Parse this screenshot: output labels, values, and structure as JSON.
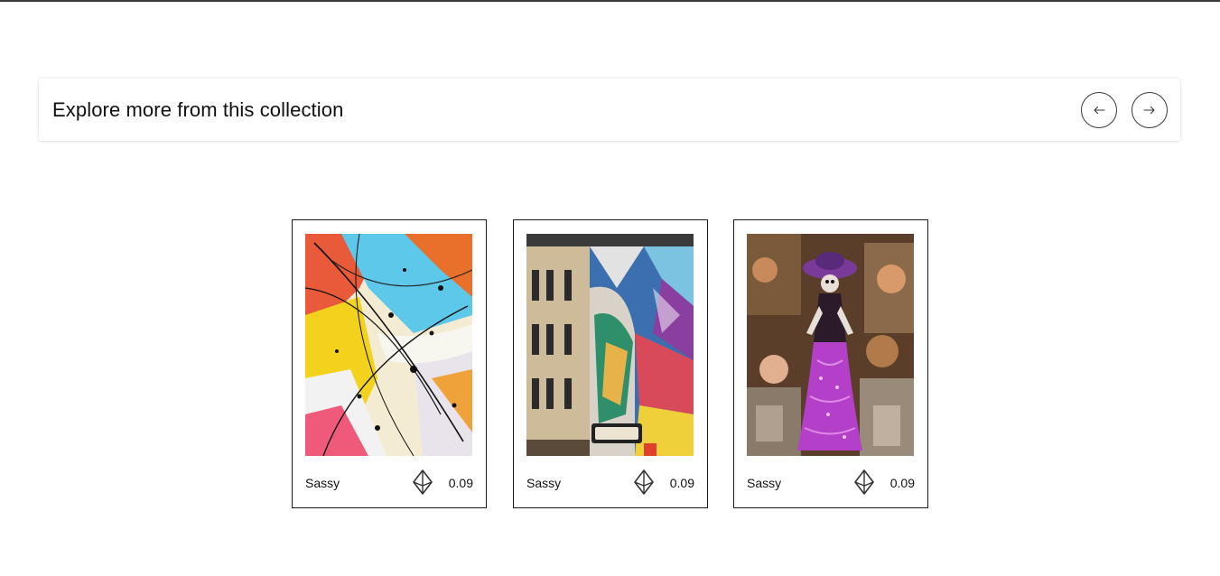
{
  "collection": {
    "title": "Explore more from this collection",
    "prev_icon": "arrow-left-icon",
    "next_icon": "arrow-right-icon"
  },
  "cards": [
    {
      "creator": "Sassy",
      "price": "0.09",
      "currency_icon": "ethereum-icon",
      "artwork": "abstract-paint-splatter"
    },
    {
      "creator": "Sassy",
      "price": "0.09",
      "currency_icon": "ethereum-icon",
      "artwork": "street-mural-building"
    },
    {
      "creator": "Sassy",
      "price": "0.09",
      "currency_icon": "ethereum-icon",
      "artwork": "catrina-figure-market"
    }
  ],
  "colors": {
    "border": "#1a1a1a",
    "text": "#111111",
    "accent_purple": "#b43fc8"
  }
}
